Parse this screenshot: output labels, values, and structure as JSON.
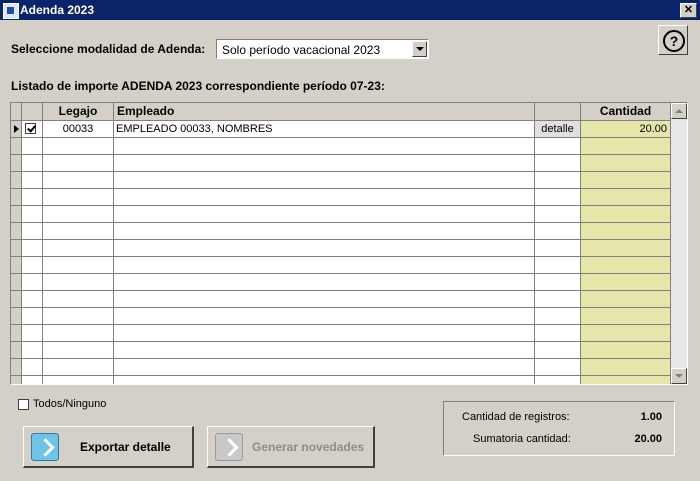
{
  "window": {
    "title": "Adenda 2023"
  },
  "modalidad": {
    "label": "Seleccione modalidad de Adenda:",
    "selected": "Solo período vacacional 2023"
  },
  "listado": {
    "title": "Listado de importe ADENDA 2023 correspondiente período 07-23:"
  },
  "grid": {
    "headers": {
      "legajo": "Legajo",
      "empleado": "Empleado",
      "cantidad": "Cantidad"
    },
    "rows": [
      {
        "checked": true,
        "legajo": "00033",
        "empleado": "EMPLEADO 00033, NOMBRES",
        "detalle": "detalle",
        "cantidad": "20.00"
      }
    ]
  },
  "todos_ninguno": {
    "label": "Todos/Ninguno",
    "checked": false
  },
  "buttons": {
    "exportar": "Exportar detalle",
    "generar": "Generar novedades"
  },
  "summary": {
    "registros_label": "Cantidad de registros:",
    "registros_value": "1.00",
    "sumatoria_label": "Sumatoria cantidad:",
    "sumatoria_value": "20.00"
  },
  "colors": {
    "titlebar": "#0a246a",
    "cantidad_column": "#e6e6aa",
    "window_bg": "#d4d0c8"
  },
  "icons": {
    "app": "app-icon",
    "close": "close-icon",
    "help": "question-mark-icon",
    "export": "export-arrow-icon",
    "generate": "generate-arrow-icon"
  }
}
